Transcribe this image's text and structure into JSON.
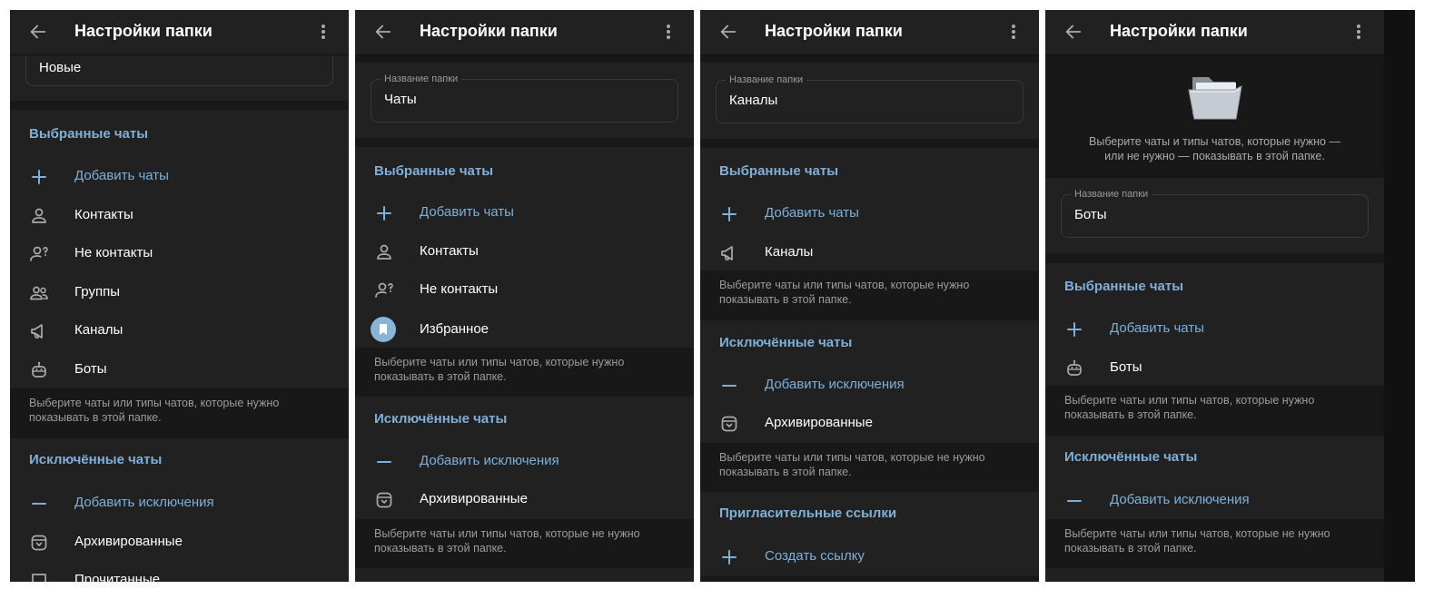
{
  "header": {
    "title": "Настройки папки"
  },
  "panel1": {
    "folder_name_value": "Новые",
    "included": {
      "title": "Выбранные чаты",
      "items": [
        {
          "label": "Добавить чаты"
        },
        {
          "label": "Контакты"
        },
        {
          "label": "Не контакты"
        },
        {
          "label": "Группы"
        },
        {
          "label": "Каналы"
        },
        {
          "label": "Боты"
        }
      ],
      "hint_line1": "Выберите чаты или типы чатов, которые нужно",
      "hint_line2": "показывать в этой папке."
    },
    "excluded": {
      "title": "Исключённые чаты",
      "items": [
        {
          "label": "Добавить исключения"
        },
        {
          "label": "Архивированные"
        },
        {
          "label": "Прочитанные"
        }
      ]
    }
  },
  "panel2": {
    "folder_name_label": "Название папки",
    "folder_name_value": "Чаты",
    "included": {
      "title": "Выбранные чаты",
      "items": [
        {
          "label": "Добавить чаты"
        },
        {
          "label": "Контакты"
        },
        {
          "label": "Не контакты"
        },
        {
          "label": "Избранное"
        }
      ],
      "hint_line1": "Выберите чаты или типы чатов, которые нужно",
      "hint_line2": "показывать в этой папке."
    },
    "excluded": {
      "title": "Исключённые чаты",
      "items": [
        {
          "label": "Добавить исключения"
        },
        {
          "label": "Архивированные"
        }
      ],
      "hint_line1": "Выберите чаты или типы чатов, которые не нужно",
      "hint_line2": "показывать в этой папке."
    }
  },
  "panel3": {
    "folder_name_label": "Название папки",
    "folder_name_value": "Каналы",
    "included": {
      "title": "Выбранные чаты",
      "items": [
        {
          "label": "Добавить чаты"
        },
        {
          "label": "Каналы"
        }
      ],
      "hint_line1": "Выберите чаты или типы чатов, которые нужно",
      "hint_line2": "показывать в этой папке."
    },
    "excluded": {
      "title": "Исключённые чаты",
      "items": [
        {
          "label": "Добавить исключения"
        },
        {
          "label": "Архивированные"
        }
      ],
      "hint_line1": "Выберите чаты или типы чатов, которые не нужно",
      "hint_line2": "показывать в этой папке."
    },
    "invite": {
      "title": "Пригласительные ссылки",
      "items": [
        {
          "label": "Создать ссылку"
        }
      ]
    }
  },
  "panel4": {
    "intro_line1": "Выберите чаты и типы чатов, которые нужно —",
    "intro_line2": "или не нужно — показывать в этой папке.",
    "folder_name_label": "Название папки",
    "folder_name_value": "Боты",
    "included": {
      "title": "Выбранные чаты",
      "items": [
        {
          "label": "Добавить чаты"
        },
        {
          "label": "Боты"
        }
      ],
      "hint_line1": "Выберите чаты или типы чатов, которые нужно",
      "hint_line2": "показывать в этой папке."
    },
    "excluded": {
      "title": "Исключённые чаты",
      "items": [
        {
          "label": "Добавить исключения"
        }
      ],
      "hint_line1": "Выберите чаты или типы чатов, которые не нужно",
      "hint_line2": "показывать в этой папке."
    }
  },
  "colors": {
    "background": "#181818",
    "surface": "#212121",
    "accent": "#7eb0d9",
    "text": "#ffffff",
    "secondary_text": "#9c9c9c"
  }
}
